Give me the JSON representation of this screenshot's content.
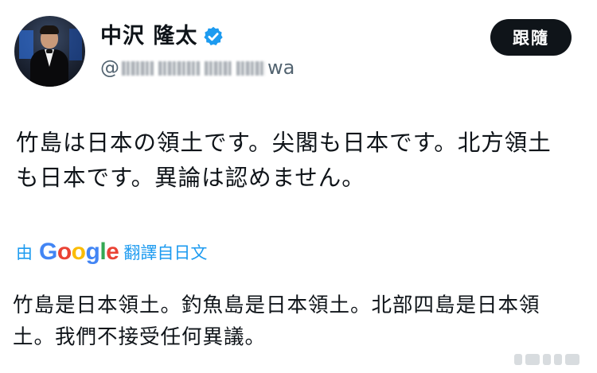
{
  "user": {
    "display_name": "中沢 隆太",
    "handle_start": "@",
    "handle_end": "wa",
    "verified_icon": "verified-badge-icon",
    "verified_color": "#1d9bf0"
  },
  "follow_button": {
    "label": "跟隨"
  },
  "tweet": {
    "text": "竹島は日本の領土です。尖閣も日本です。北方領土も日本です。異論は認めません。"
  },
  "translation": {
    "prefix": "由",
    "provider": "Google",
    "suffix": "翻譯自日文",
    "text": "竹島是日本領土。釣魚島是日本領土。北部四島是日本領土。我們不接受任何異議。",
    "link_color": "#1d9bf0"
  }
}
